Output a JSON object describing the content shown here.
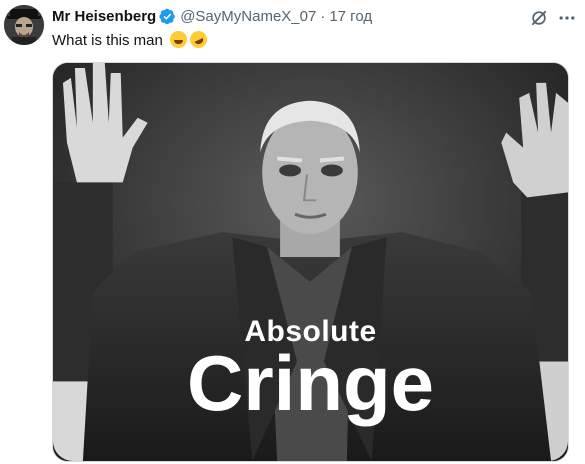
{
  "tweet": {
    "author_name": "Mr Heisenberg",
    "handle": "@SayMyNameX_07",
    "separator": "·",
    "time": "17 год",
    "text": "What is this man",
    "emojis": [
      "joy-emoji",
      "rofl-emoji"
    ]
  },
  "media": {
    "caption_line1": "Absolute",
    "caption_line2": "Cringe"
  },
  "icons": {
    "verified": "verified-badge-icon",
    "grok": "grok-icon",
    "more": "more-icon"
  },
  "colors": {
    "verified_blue": "#1d9bf0",
    "secondary_text": "#536471",
    "primary_text": "#0f1419"
  }
}
